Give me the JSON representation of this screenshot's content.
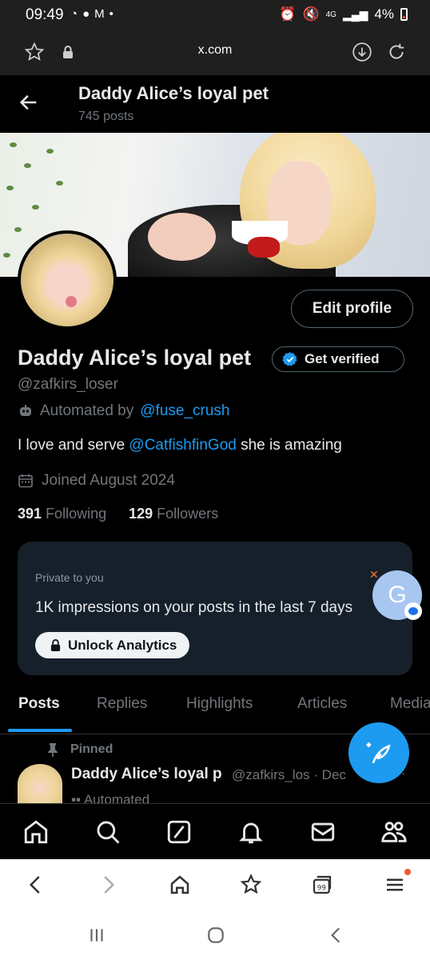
{
  "status_bar": {
    "time": "09:49",
    "battery": "4%",
    "network": "4G"
  },
  "browser": {
    "url": "x.com"
  },
  "header": {
    "title": "Daddy Alice’s loyal pet",
    "posts_count": "745 posts"
  },
  "profile": {
    "name": "Daddy Alice’s loyal pet",
    "handle": "@zafkirs_loser",
    "automated_prefix": "Automated by",
    "automated_link": "@fuse_crush",
    "bio_prefix": "I love and serve",
    "bio_mention": "@CatfishfinGod",
    "bio_suffix": "she is amazing",
    "joined": "Joined August 2024",
    "following_count": "391",
    "following_label": "Following",
    "followers_count": "129",
    "followers_label": "Followers",
    "edit_profile_label": "Edit profile",
    "get_verified_label": "Get verified"
  },
  "analytics_card": {
    "private_label": "Private to you",
    "impressions_text": "1K impressions on your posts in the last 7 days",
    "unlock_label": "Unlock Analytics"
  },
  "assistant_bubble": {
    "letter": "G"
  },
  "tabs": [
    {
      "label": "Posts",
      "active": true
    },
    {
      "label": "Replies",
      "active": false
    },
    {
      "label": "Highlights",
      "active": false
    },
    {
      "label": "Articles",
      "active": false
    },
    {
      "label": "Media",
      "active": false
    }
  ],
  "pinned_post": {
    "pinned_label": "Pinned",
    "author_name": "Daddy Alice’s loyal p",
    "author_handle": "@zafkirs_los · Dec",
    "more": "···",
    "automated_text": "Automated"
  },
  "colors": {
    "accent": "#1d9bf0",
    "background": "#000000",
    "card": "#15202b",
    "muted": "#71767b"
  },
  "icons": {
    "app_nav": [
      "home-icon",
      "search-icon",
      "grok-icon",
      "notifications-icon",
      "messages-icon",
      "communities-icon"
    ],
    "browser_nav": [
      "back-icon",
      "forward-icon",
      "home-icon",
      "bookmarks-icon",
      "tabs-icon",
      "menu-icon"
    ],
    "browser_tabs_count": "99"
  }
}
